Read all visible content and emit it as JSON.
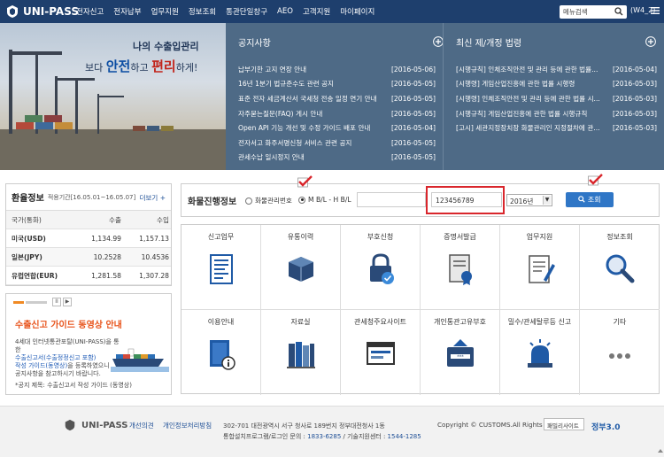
{
  "header": {
    "logo": "UNI-PASS",
    "nav": [
      "전자신고",
      "전자납부",
      "업무지원",
      "정보조회",
      "통관단일창구",
      "AEO",
      "고객지원",
      "마이페이지"
    ],
    "search_placeholder": "메뉴검색",
    "version": "(W4_2)"
  },
  "hero": {
    "line1": "나의 수출입관리",
    "line2_prefix": "보다",
    "line2_accent1": "안전",
    "line2_mid": "하고",
    "line2_accent2": "편리",
    "line2_suffix": "하게!"
  },
  "notice": {
    "title": "공지사항",
    "items": [
      {
        "text": "납부기한 고지 연장 안내",
        "date": "[2016-05-06]"
      },
      {
        "text": "16년 1분기 법규준수도 관련 공지",
        "date": "[2016-05-05]"
      },
      {
        "text": "표준 전자 세금계산서 국세청 전송 일정 연기 안내",
        "date": "[2016-05-05]"
      },
      {
        "text": "자주묻는질문(FAQ) 게시 안내",
        "date": "[2016-05-05]"
      },
      {
        "text": "Open API 기능 개선 및 수정 가이드 배포 안내",
        "date": "[2016-05-04]"
      },
      {
        "text": "전자서고 화주서명신청 서비스 관련 공지",
        "date": "[2016-05-05]"
      },
      {
        "text": "관세수납 일시정지 안내",
        "date": "[2016-05-05]"
      }
    ]
  },
  "latest": {
    "title": "최신 제/개정 법령",
    "items": [
      {
        "text": "[시행규칙] 인체조직안전 및 관리 등에 관한 법률...",
        "date": "[2016-05-04]"
      },
      {
        "text": "[시행령] 게임산업진흥에 관한 법률 시행령",
        "date": "[2016-05-03]"
      },
      {
        "text": "[시행령] 인체조직안전 및 관리 등에 관한 법률 시...",
        "date": "[2016-05-03]"
      },
      {
        "text": "[시행규칙] 게임산업진흥에 관한 법률 시행규칙",
        "date": "[2016-05-03]"
      },
      {
        "text": "[고시] 세관지정장치장 화물관리인 지정절차에 관...",
        "date": "[2016-05-03]"
      }
    ]
  },
  "exchange": {
    "title": "환율정보",
    "period": "적용기간[16.05.01~16.05.07]",
    "more": "더보기 +",
    "columns": [
      "국가(통화)",
      "수출",
      "수입"
    ],
    "rows": [
      {
        "country": "미국(USD)",
        "export": "1,134.99",
        "import": "1,157.13"
      },
      {
        "country": "일본(JPY)",
        "export": "10.2528",
        "import": "10.4536"
      },
      {
        "country": "유럽연합(EUR)",
        "export": "1,281.58",
        "import": "1,307.28"
      }
    ]
  },
  "guide": {
    "title": "수출신고 가이드 동영상 안내",
    "body_line1": "4세대 인터넷통관포탈(UNI-PASS)을 통한",
    "body_link1": "수출신고서(수출정정신고 포함)",
    "body_link2": "작성 가이드(동영상)",
    "body_line3": "을 등록하였으니",
    "body_line4": "공지사항을 참고하시기 바랍니다.",
    "subject": "*공지 제목: 수출신고서 작성 가이드 (동영상)",
    "pause": "II",
    "next": "▶"
  },
  "tracking": {
    "title": "화물진행정보",
    "radio1": "화물관리번호",
    "radio2": "M B/L - H B/L",
    "input2_value": "123456789",
    "year": "2016년",
    "button": "조회"
  },
  "services": [
    {
      "label": "신고업무",
      "icon": "form-icon"
    },
    {
      "label": "유통이력",
      "icon": "boxes-icon"
    },
    {
      "label": "부호신청",
      "icon": "lock-icon"
    },
    {
      "label": "증명서발급",
      "icon": "certificate-icon"
    },
    {
      "label": "업무지원",
      "icon": "document-pen-icon"
    },
    {
      "label": "정보조회",
      "icon": "magnifier-icon"
    },
    {
      "label": "이용안내",
      "icon": "book-info-icon"
    },
    {
      "label": "자료실",
      "icon": "books-icon"
    },
    {
      "label": "관세청주요사이트",
      "icon": "browser-icon"
    },
    {
      "label": "개인통관고유부호",
      "icon": "id-card-icon"
    },
    {
      "label": "밀수/관세탈루등 신고",
      "icon": "siren-icon"
    },
    {
      "label": "기타",
      "icon": "more-icon"
    }
  ],
  "footer": {
    "logo": "UNI-PASS",
    "link1": "개선의견",
    "link2": "개인정보처리방침",
    "addr1": "302-701 대전광역시 서구 청사로 189번지 정부대전청사 1동",
    "addr2_prefix": "통합설치프로그램/로그인 문의 : ",
    "phone1": "1833-6285",
    "addr2_mid": " / 기술지원센터 : ",
    "phone2": "1544-1285",
    "copyright": "Copyright © CUSTOMS.All Rights Reserved.",
    "family_select": "패밀리사이트",
    "gov": "정부3.0"
  },
  "colors": {
    "nav": "#1e3f6d",
    "panel": "#4e6a86",
    "accent": "#2f76c6",
    "red": "#d9262c"
  }
}
